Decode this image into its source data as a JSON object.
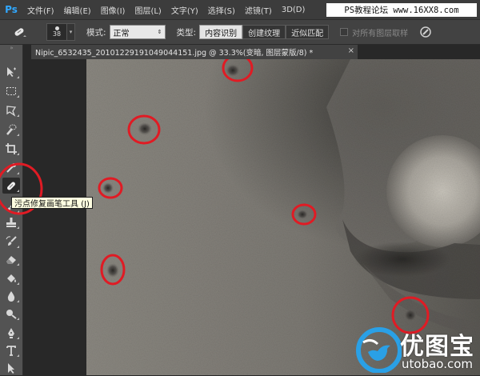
{
  "app": {
    "logo": "Ps",
    "accent": "#31a8ff"
  },
  "menu": {
    "items": [
      "文件(F)",
      "编辑(E)",
      "图像(I)",
      "图层(L)",
      "文字(Y)",
      "选择(S)",
      "滤镜(T)",
      "3D(D)"
    ],
    "forum_banner": "PS教程论坛 www.16XX8.com"
  },
  "options": {
    "tool_icon": "spot-healing-brush-icon",
    "brush_size": "38",
    "mode_label": "模式:",
    "mode_value": "正常",
    "type_label": "类型:",
    "type_buttons": [
      "内容识别",
      "创建纹理",
      "近似匹配"
    ],
    "type_selected": "内容识别",
    "sample_all_label": "对所有图层取样",
    "pressure_icon": "pressure-size-icon"
  },
  "toolbox": {
    "tools": [
      "move-icon",
      "marquee-icon",
      "lasso-icon",
      "quick-select-icon",
      "crop-icon",
      "eyedropper-icon",
      "spot-healing-brush-icon",
      "brush-icon",
      "clone-stamp-icon",
      "history-brush-icon",
      "eraser-icon",
      "paint-bucket-icon",
      "blur-icon",
      "dodge-icon",
      "pen-icon",
      "type-icon",
      "path-select-icon"
    ],
    "active_tool": "spot-healing-brush-icon"
  },
  "document": {
    "tab_title": "Nipic_6532435_20101229191049044151.jpg @ 33.3%(变暗, 图层蒙版/8) *",
    "close_icon": "close-icon"
  },
  "tooltip": {
    "text": "污点修复画笔工具 (J)"
  },
  "watermark": {
    "brand": "优图宝",
    "url": "utobao.com",
    "logo_icon": "bird-icon",
    "color": "#2aa0e6"
  },
  "annotation_color": "#e01b24"
}
